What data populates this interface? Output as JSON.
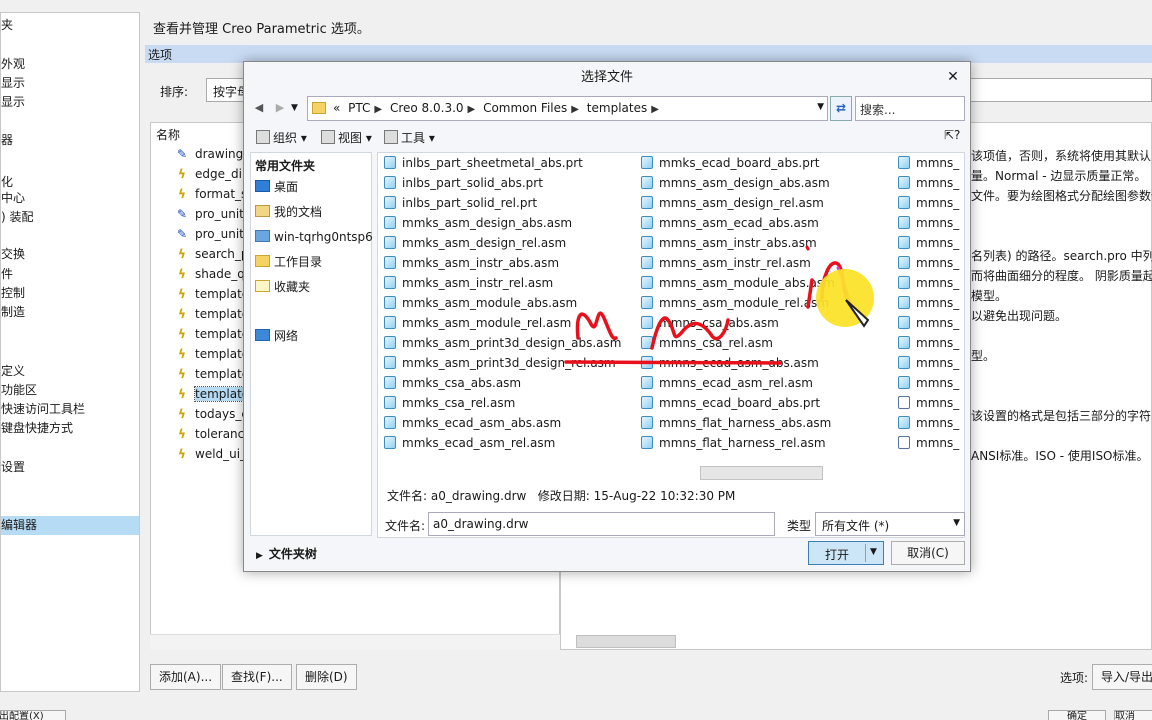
{
  "background": {
    "nav_items": [
      "夹",
      "外观",
      "显示",
      "显示",
      "器",
      "化",
      "中心",
      ") 装配",
      "交换",
      "件",
      "控制",
      "制造",
      "定义",
      "功能区",
      "快速访问工具栏",
      "键盘快捷方式",
      "设置",
      "编辑器"
    ],
    "description": "查看并管理 Creo Parametric 选项。",
    "options_strip": "选项",
    "sort_label": "排序:",
    "sort_value": "按字母",
    "list_header": "名称",
    "option_rows": [
      "drawing",
      "edge_di",
      "format_s",
      "pro_unit",
      "pro_unit",
      "search_p",
      "shade_q",
      "template",
      "template",
      "template",
      "template",
      "template",
      "template",
      "todays_c",
      "toleranc",
      "weld_ui_"
    ],
    "detail_lines": [
      "该项值，否则，系统将使用其默认",
      "量。Normal - 边显示质量正常。",
      "文件。要为绘图格式分配绘图参数值",
      "名列表) 的路径。search.pro 中列出",
      "而将曲面细分的程度。 阴影质量起",
      "模型。",
      "以避免出现问题。",
      "型。",
      "该设置的格式是包括三部分的字符",
      "ANSI标准。ISO - 使用ISO标准。"
    ],
    "btn_add": "添加(A)...",
    "btn_find": "查找(F)...",
    "btn_delete": "删除(D)",
    "options_label": "选项:",
    "btn_import_export": "导入/导出",
    "btn_bottom_left": "出配置(X)",
    "btn_ok": "确定",
    "btn_cancel_bg": "取消"
  },
  "dialog": {
    "title": "选择文件",
    "breadcrumb_overflow": "«",
    "breadcrumbs": [
      "PTC",
      "Creo 8.0.3.0",
      "Common Files",
      "templates"
    ],
    "search_placeholder": "搜索...",
    "toolbar": {
      "organize": "组织",
      "view": "视图",
      "tools": "工具"
    },
    "sidebar": {
      "header": "常用文件夹",
      "items": [
        {
          "label": "桌面",
          "icon": "desktop-icon"
        },
        {
          "label": "我的文档",
          "icon": "documents-icon"
        },
        {
          "label": "win-tqrhg0ntsp6",
          "icon": "computer-icon"
        },
        {
          "label": "工作目录",
          "icon": "working-directory-icon"
        },
        {
          "label": "收藏夹",
          "icon": "favorites-icon"
        },
        {
          "label": "网络",
          "icon": "network-icon"
        }
      ],
      "folder_tree": "文件夹树"
    },
    "files_col1": [
      "inlbs_part_sheetmetal_abs.prt",
      "inlbs_part_solid_abs.prt",
      "inlbs_part_solid_rel.prt",
      "mmks_asm_design_abs.asm",
      "mmks_asm_design_rel.asm",
      "mmks_asm_instr_abs.asm",
      "mmks_asm_instr_rel.asm",
      "mmks_asm_module_abs.asm",
      "mmks_asm_module_rel.asm",
      "mmks_asm_print3d_design_abs.asm",
      "mmks_asm_print3d_design_rel.asm",
      "mmks_csa_abs.asm",
      "mmks_csa_rel.asm",
      "mmks_ecad_asm_abs.asm",
      "mmks_ecad_asm_rel.asm"
    ],
    "files_col2": [
      "mmks_ecad_board_abs.prt",
      "mmns_asm_design_abs.asm",
      "mmns_asm_design_rel.asm",
      "mmns_asm_ecad_abs.asm",
      "mmns_asm_instr_abs.asm",
      "mmns_asm_instr_rel.asm",
      "mmns_asm_module_abs.asm",
      "mmns_asm_module_rel.asm",
      "mmns_csa_abs.asm",
      "mmns_csa_rel.asm",
      "mmns_ecad_asm_abs.asm",
      "mmns_ecad_asm_rel.asm",
      "mmns_ecad_board_abs.prt",
      "mmns_flat_harness_abs.asm",
      "mmns_flat_harness_rel.asm"
    ],
    "files_col3": [
      "mmns_",
      "mmns_",
      "mmns_",
      "mmns_",
      "mmns_",
      "mmns_",
      "mmns_",
      "mmns_",
      "mmns_",
      "mmns_",
      "mmns_",
      "mmns_",
      "mmns_",
      "mmns_",
      "mmns_"
    ],
    "info_filename_label": "文件名:",
    "info_filename": "a0_drawing.drw",
    "info_modified_label": "修改日期:",
    "info_modified": "15-Aug-22 10:32:30 PM",
    "filename_label": "文件名:",
    "filename_value": "a0_drawing.drw",
    "type_label": "类型",
    "type_value": "所有文件 (*)",
    "open_label": "打开",
    "cancel_label": "取消(C)"
  },
  "colors": {
    "selection": "#b6dcf5",
    "annotation_red": "#e8101a",
    "annotation_pink": "#e040d0",
    "cursor_highlight": "#fce228"
  }
}
